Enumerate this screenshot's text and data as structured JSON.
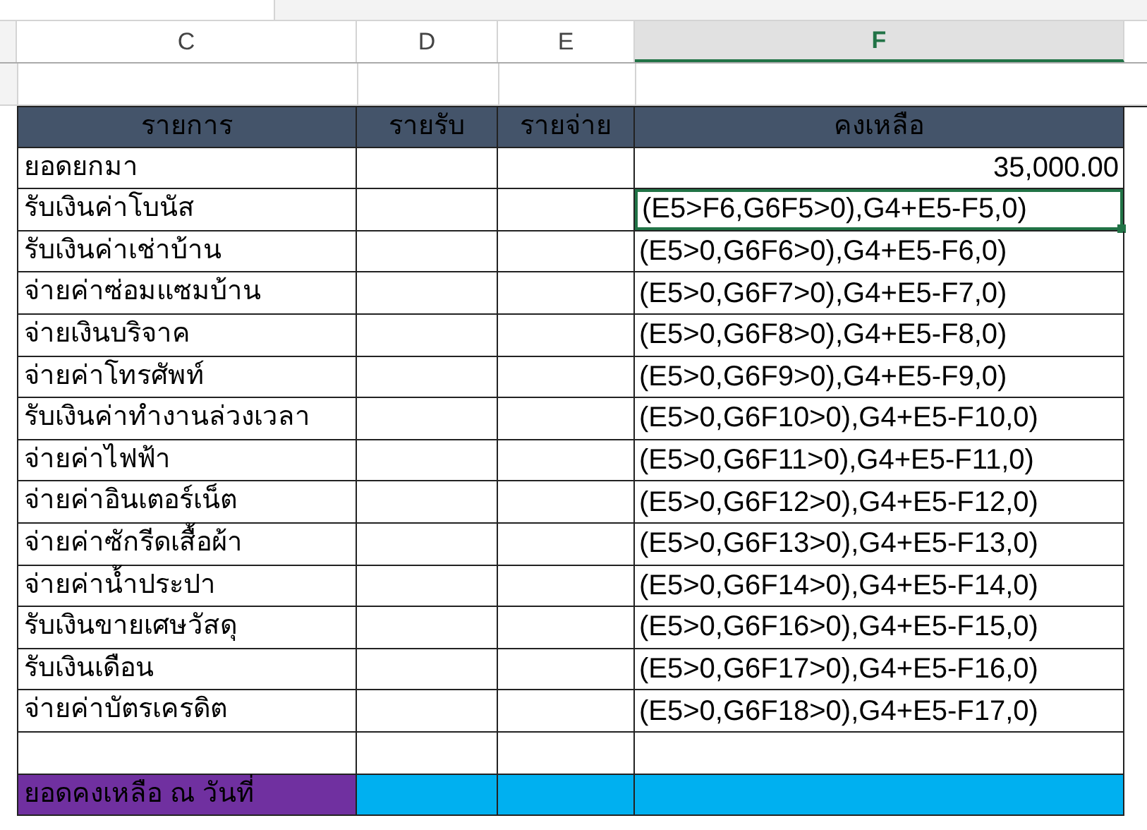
{
  "columns": [
    {
      "label": "C",
      "selected": false
    },
    {
      "label": "D",
      "selected": false
    },
    {
      "label": "E",
      "selected": false
    },
    {
      "label": "F",
      "selected": true
    }
  ],
  "table": {
    "headers": [
      "รายการ",
      "รายรับ",
      "รายจ่าย",
      "คงเหลือ"
    ],
    "rows": [
      {
        "item": "ยอดยกมา",
        "balance": "35,000.00",
        "selected": false
      },
      {
        "item": "รับเงินค่าโบนัส",
        "balance": "(E5>F6,G6F5>0),G4+E5-F5,0)",
        "selected": true
      },
      {
        "item": "รับเงินค่าเช่าบ้าน",
        "balance": "(E5>0,G6F6>0),G4+E5-F6,0)",
        "selected": false
      },
      {
        "item": "จ่ายค่าซ่อมแซมบ้าน",
        "balance": "(E5>0,G6F7>0),G4+E5-F7,0)",
        "selected": false
      },
      {
        "item": "จ่ายเงินบริจาค",
        "balance": "(E5>0,G6F8>0),G4+E5-F8,0)",
        "selected": false
      },
      {
        "item": "จ่ายค่าโทรศัพท์",
        "balance": "(E5>0,G6F9>0),G4+E5-F9,0)",
        "selected": false
      },
      {
        "item": "รับเงินค่าทำงานล่วงเวลา",
        "balance": "(E5>0,G6F10>0),G4+E5-F10,0)",
        "selected": false
      },
      {
        "item": "จ่ายค่าไฟฟ้า",
        "balance": "(E5>0,G6F11>0),G4+E5-F11,0)",
        "selected": false
      },
      {
        "item": "จ่ายค่าอินเตอร์เน็ต",
        "balance": "(E5>0,G6F12>0),G4+E5-F12,0)",
        "selected": false
      },
      {
        "item": "จ่ายค่าซักรีดเสื้อผ้า",
        "balance": "(E5>0,G6F13>0),G4+E5-F13,0)",
        "selected": false
      },
      {
        "item": "จ่ายค่าน้ำประปา",
        "balance": "(E5>0,G6F14>0),G4+E5-F14,0)",
        "selected": false
      },
      {
        "item": "รับเงินขายเศษวัสดุ",
        "balance": "(E5>0,G6F16>0),G4+E5-F15,0)",
        "selected": false
      },
      {
        "item": "รับเงินเดือน",
        "balance": "(E5>0,G6F17>0),G4+E5-F16,0)",
        "selected": false
      },
      {
        "item": "จ่ายค่าบัตรเครดิต",
        "balance": "(E5>0,G6F18>0),G4+E5-F17,0)",
        "selected": false
      }
    ],
    "total": {
      "label": "ยอดคงเหลือ ณ วันที่"
    }
  }
}
